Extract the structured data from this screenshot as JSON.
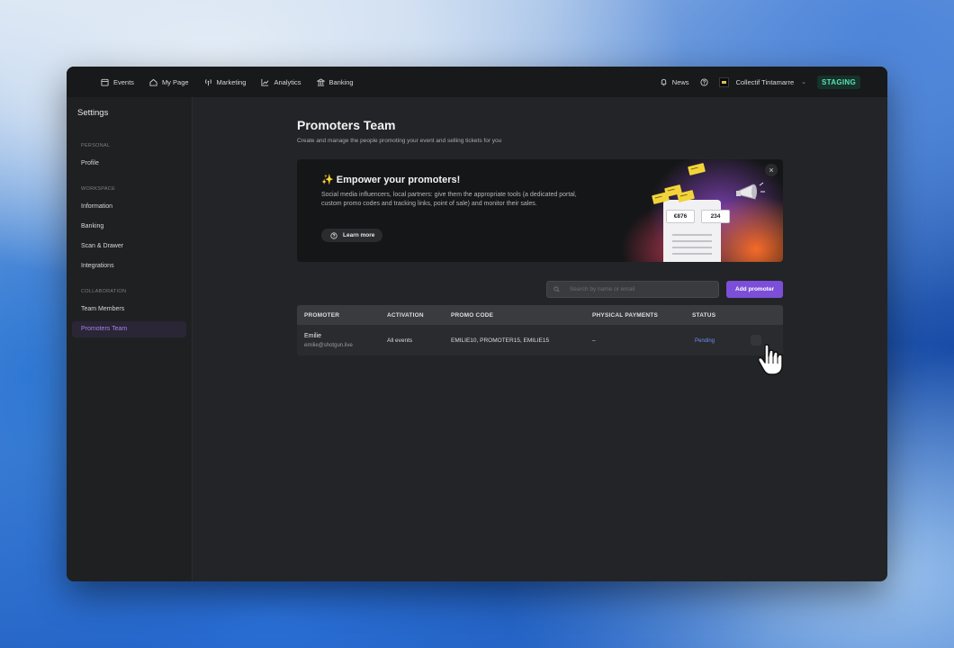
{
  "topbar": {
    "nav": [
      {
        "label": "Events",
        "icon": "calendar-icon"
      },
      {
        "label": "My Page",
        "icon": "home-icon"
      },
      {
        "label": "Marketing",
        "icon": "broadcast-icon"
      },
      {
        "label": "Analytics",
        "icon": "chart-icon"
      },
      {
        "label": "Banking",
        "icon": "bank-icon"
      }
    ],
    "news_label": "News",
    "org_name": "Collectif Tintamarre",
    "org_chevron": "⌄",
    "env_badge": "STAGING"
  },
  "sidebar": {
    "title": "Settings",
    "sections": [
      {
        "label": "PERSONAL",
        "items": [
          "Profile"
        ]
      },
      {
        "label": "WORKSPACE",
        "items": [
          "Information",
          "Banking",
          "Scan & Drawer",
          "Integrations"
        ]
      },
      {
        "label": "COLLABORATION",
        "items": [
          "Team Members",
          "Promoters Team"
        ]
      }
    ],
    "active_item": "Promoters Team"
  },
  "main": {
    "title": "Promoters Team",
    "subtitle": "Create and manage the people promoting your event and selling tickets for you",
    "banner": {
      "title": "✨ Empower your promoters!",
      "text": "Social media influencers, local partners: give them the appropriate tools (a dedicated portal, custom promo codes and tracking links, point of sale) and monitor their sales.",
      "learn_more": "Learn more",
      "close": "×",
      "illustration_amount": "€876",
      "illustration_count": "234"
    },
    "search": {
      "placeholder": "Search by name or email",
      "value": ""
    },
    "add_button": "Add promoter",
    "table": {
      "columns": [
        "PROMOTER",
        "ACTIVATION",
        "PROMO CODE",
        "PHYSICAL PAYMENTS",
        "STATUS"
      ],
      "rows": [
        {
          "name": "Emilie",
          "email": "emilie@shotgun.live",
          "activation": "All events",
          "promo_codes": "EMILIE10, PROMOTER15, EMILIE15",
          "physical_payments": "–",
          "status": "Pending"
        }
      ]
    }
  },
  "colors": {
    "accent": "#7b4fd8",
    "active_nav_text": "#9f84e8",
    "status_pending": "#6d8ef0",
    "staging_text": "#5ee0b1",
    "staging_bg": "#16322b"
  }
}
